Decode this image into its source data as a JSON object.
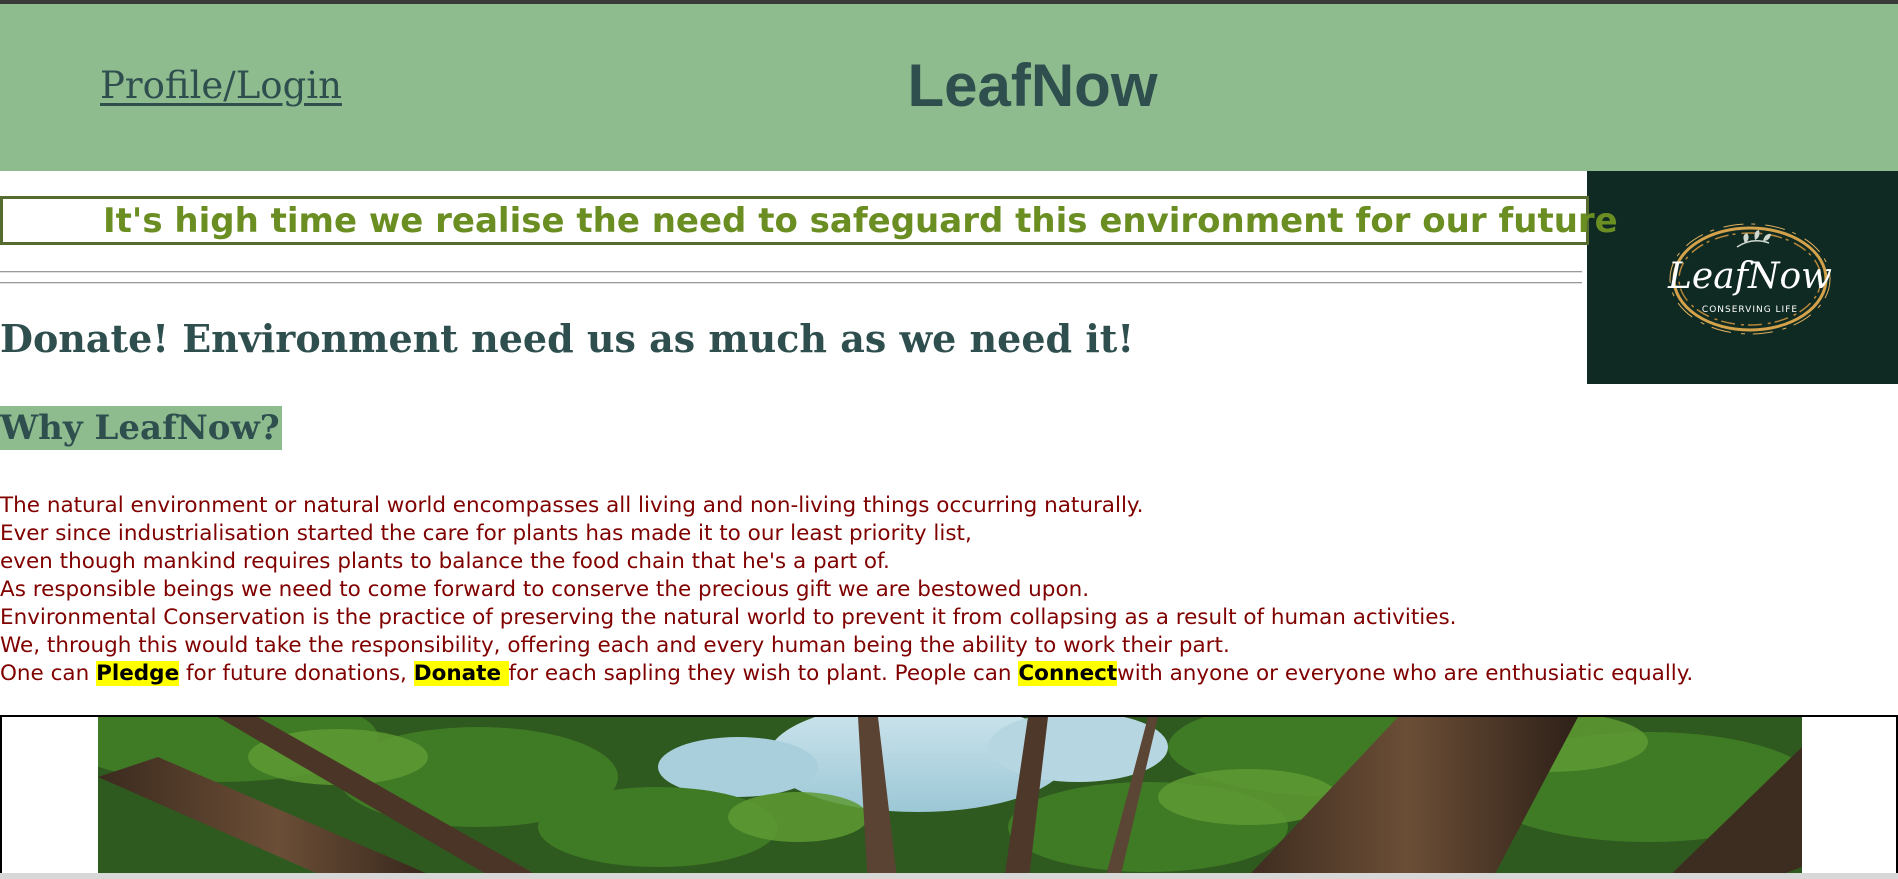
{
  "header": {
    "profile_link": "Profile/Login",
    "brand": "LeafNow"
  },
  "logo": {
    "title": "LeafNow",
    "subtitle": "CONSERVING LIFE"
  },
  "tagline": "It's high time we realise the need to safeguard this environment for our future",
  "headings": {
    "donate": "Donate! Environment need us as much as we need it!",
    "why": "Why LeafNow?"
  },
  "paragraph": {
    "lines": [
      "The natural environment or natural world encompasses all living and non-living things occurring naturally.",
      "Ever since industrialisation started the care for plants has made it to our least priority list,",
      "even though mankind requires plants to balance the food chain that he's a part of.",
      "As responsible beings we need to come forward to conserve the precious gift we are bestowed upon.",
      "Environmental Conservation is the practice of preserving the natural world to prevent it from collapsing as a result of human activities.",
      "We, through this would take the responsibility, offering each and every human being the ability to work their part."
    ],
    "last_line": {
      "part1": "One can ",
      "pledge": "Pledge",
      "part2": " for future donations, ",
      "donate": "Donate ",
      "part3": "for each sapling they wish to plant. People can ",
      "connect": "Connect",
      "part4": "with anyone or everyone who are enthusiatic equally."
    }
  },
  "colors": {
    "header_bg": "#8fbc8f",
    "brand_text": "#2f4f4f",
    "tagline_text": "#6b8e23",
    "paragraph_text": "#800000",
    "highlight": "#ffff00",
    "logo_bg": "#0f2a22",
    "logo_gold": "#d4a24a"
  },
  "icons": {
    "logo": "leafnow-logo-icon",
    "photo": "forest-canopy-image"
  }
}
